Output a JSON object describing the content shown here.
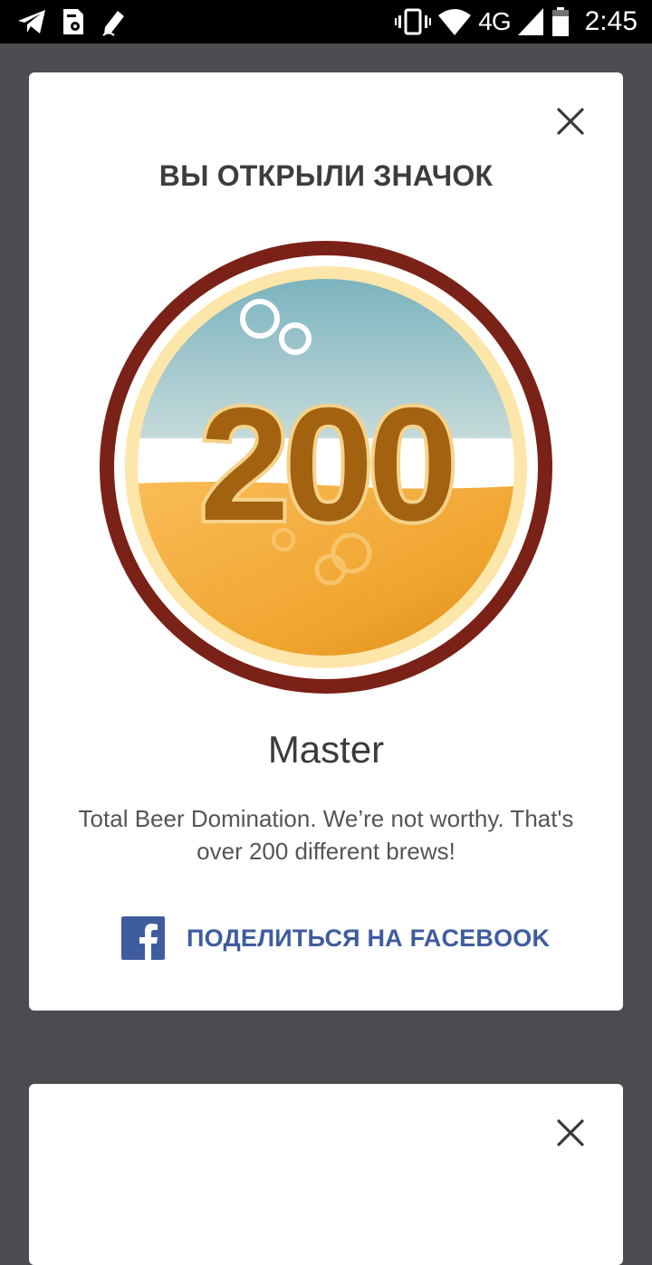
{
  "status_bar": {
    "network": "4G",
    "time": "2:45"
  },
  "dialog": {
    "title": "ВЫ ОТКРЫЛИ ЗНАЧОК",
    "badge": {
      "number": "200",
      "name": "Master",
      "description": "Total Beer Domination. We’re not worthy. That's over 200 different brews!"
    },
    "share_label": "ПОДЕЛИТЬСЯ НА FACEBOOK"
  },
  "colors": {
    "background": "#4a4c50",
    "facebook": "#3f5c9e",
    "badge_ring": "#7a2118",
    "badge_digits": "#a3620f"
  },
  "icons": [
    "telegram-icon",
    "sim-settings-icon",
    "pencil-icon",
    "vibrate-icon",
    "wifi-icon",
    "signal-icon",
    "battery-icon",
    "close-icon",
    "facebook-icon"
  ]
}
